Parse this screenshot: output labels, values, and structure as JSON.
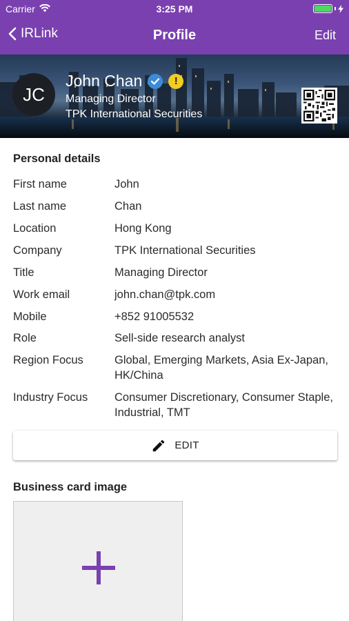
{
  "status_bar": {
    "carrier": "Carrier",
    "time": "3:25 PM",
    "battery_level": 1.0
  },
  "nav": {
    "back_label": "IRLink",
    "title": "Profile",
    "edit_label": "Edit"
  },
  "profile_header": {
    "initials": "JC",
    "name": "John Chan",
    "role": "Managing Director",
    "company": "TPK International Securities",
    "warning_badge": "!"
  },
  "personal_details": {
    "title": "Personal details",
    "rows": [
      {
        "label": "First name",
        "value": "John"
      },
      {
        "label": "Last name",
        "value": "Chan"
      },
      {
        "label": "Location",
        "value": "Hong Kong"
      },
      {
        "label": "Company",
        "value": "TPK International Securities"
      },
      {
        "label": "Title",
        "value": "Managing Director"
      },
      {
        "label": "Work email",
        "value": "john.chan@tpk.com"
      },
      {
        "label": "Mobile",
        "value": "+852 91005532"
      },
      {
        "label": "Role",
        "value": "Sell-side research analyst"
      },
      {
        "label": "Region Focus",
        "value": "Global, Emerging Markets, Asia Ex-Japan, HK/China"
      },
      {
        "label": "Industry Focus",
        "value": "Consumer Discretionary, Consumer Staple, Industrial, TMT"
      }
    ],
    "edit_button_label": "EDIT"
  },
  "business_card": {
    "title": "Business card image"
  },
  "colors": {
    "primary": "#7a40b0",
    "verified": "#3d8bd6",
    "warning": "#f1cc24",
    "battery": "#4cd964"
  }
}
